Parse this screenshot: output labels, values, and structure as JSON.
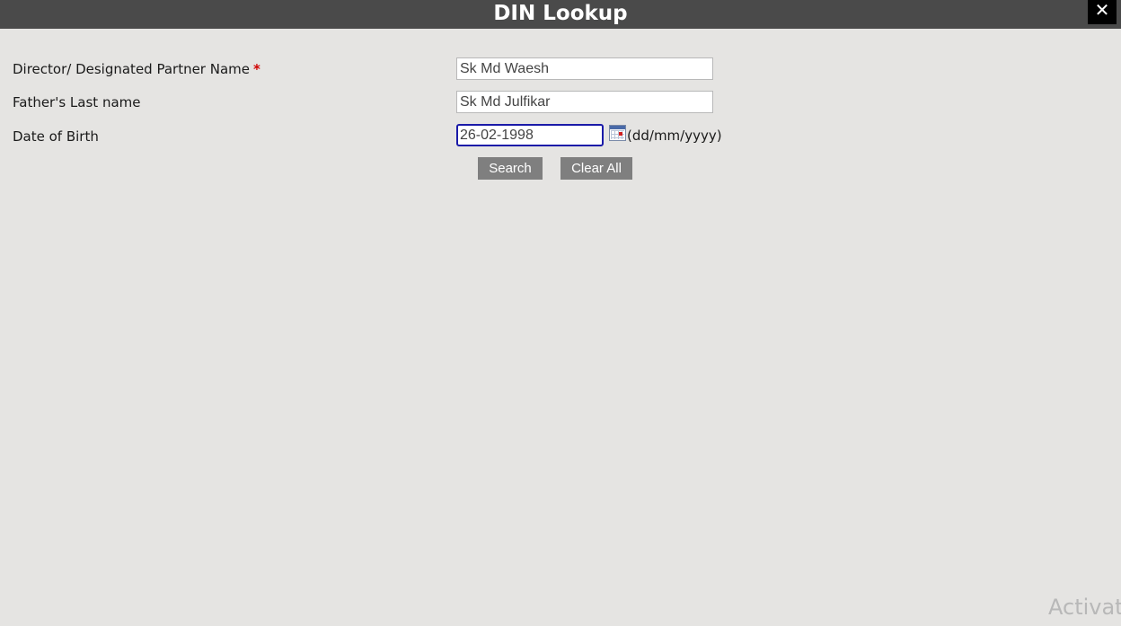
{
  "window": {
    "title": "DIN Lookup",
    "close_label": "✕"
  },
  "form": {
    "name_label": "Director/ Designated Partner Name",
    "required_mark": "*",
    "name_value": "Sk Md Waesh",
    "father_label": "Father's Last name",
    "father_value": "Sk Md Julfikar",
    "dob_label": "Date of Birth",
    "dob_value": "26-02-1998",
    "dob_format_hint": "(dd/mm/yyyy)",
    "calendar_icon": "calendar-icon"
  },
  "actions": {
    "search_label": "Search",
    "clear_label": "Clear All"
  },
  "watermark": {
    "text": "Activate"
  },
  "colors": {
    "titlebar": "#4a4a4a",
    "background": "#e5e4e2",
    "button": "#7f7f7f",
    "required": "#d00000",
    "focus_border": "#1a1aa8"
  }
}
